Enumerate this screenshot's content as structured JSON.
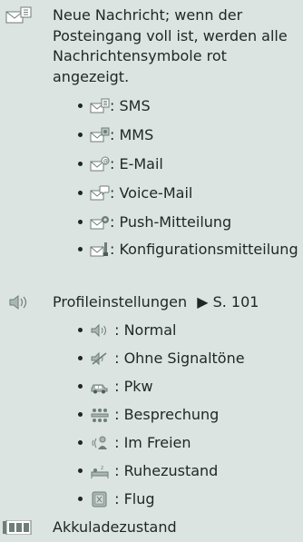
{
  "new_message": {
    "text": "Neue Nachricht; wenn der Posteingang voll ist, werden alle Nachrichtensymbole rot angezeigt.",
    "types": [
      {
        "icon": "sms-envelope-icon",
        "label": ": SMS"
      },
      {
        "icon": "mms-envelope-icon",
        "label": ": MMS"
      },
      {
        "icon": "email-envelope-icon",
        "label": ": E-Mail"
      },
      {
        "icon": "voicemail-envelope-icon",
        "label": ": Voice-Mail"
      },
      {
        "icon": "push-message-icon",
        "label": ": Push-Mitteilung"
      },
      {
        "icon": "configuration-message-icon",
        "label": ": Konfigurationsmitteilung"
      }
    ]
  },
  "profiles": {
    "label": "Profileinstellungen",
    "ref": "▶ S. 101",
    "items": [
      {
        "icon": "speaker-normal-icon",
        "label": " : Normal"
      },
      {
        "icon": "speaker-muted-icon",
        "label": " : Ohne Signaltöne"
      },
      {
        "icon": "car-icon",
        "label": " : Pkw"
      },
      {
        "icon": "meeting-icon",
        "label": " : Besprechung"
      },
      {
        "icon": "outdoor-icon",
        "label": " : Im Freien"
      },
      {
        "icon": "sleep-icon",
        "label": " : Ruhezustand"
      },
      {
        "icon": "airplane-mode-icon",
        "label": " : Flug"
      }
    ]
  },
  "battery": {
    "label": "Akkuladezustand"
  }
}
